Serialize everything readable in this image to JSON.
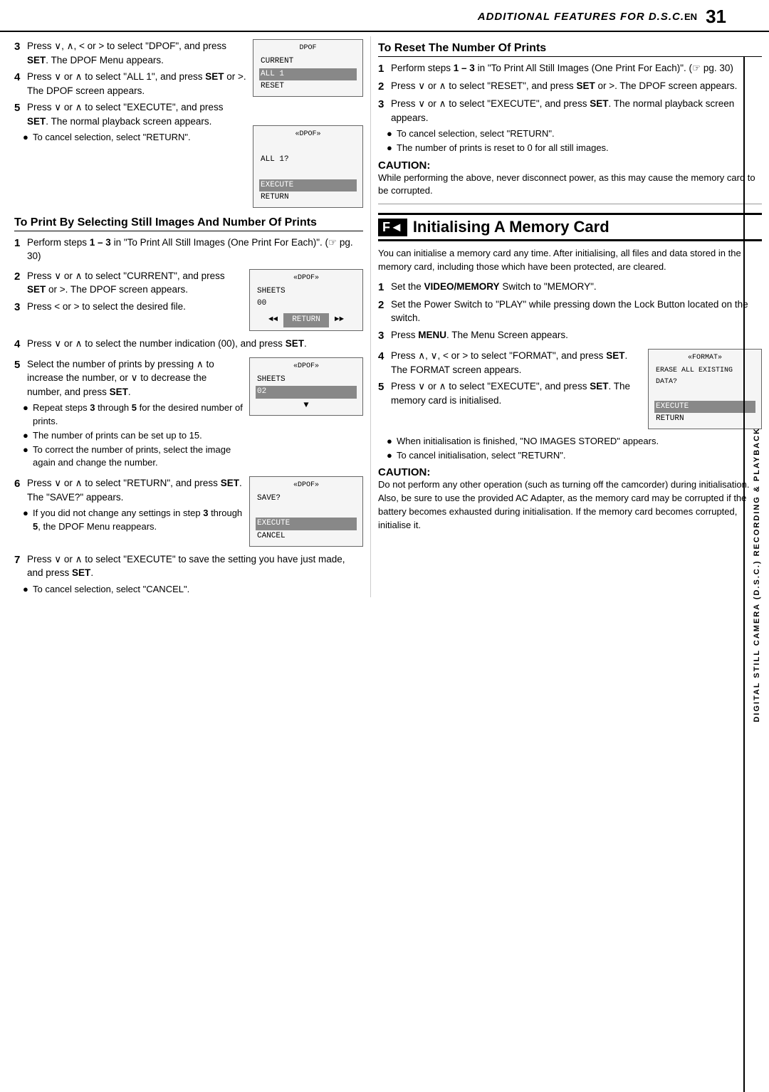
{
  "header": {
    "title": "ADDITIONAL FEATURES FOR D.S.C.",
    "en_label": "EN",
    "page_number": "31"
  },
  "side_label": {
    "text": "DIGITAL STILL CAMERA (D.S.C.) RECORDING & PLAYBACK"
  },
  "left_column": {
    "top_steps": [
      {
        "num": "3",
        "text": "Press ∨, ∧, < or > to select \"DPOF\", and press SET. The DPOF Menu appears."
      },
      {
        "num": "4",
        "text": "Press ∨ or ∧ to select \"ALL 1\", and press SET or >. The DPOF screen appears."
      },
      {
        "num": "5",
        "text": "Press ∨ or ∧ to select \"EXECUTE\", and press SET. The normal playback screen appears."
      }
    ],
    "top_bullet": "To cancel selection, select \"RETURN\".",
    "top_screen1": {
      "title": "DPOF",
      "rows": [
        "CURRENT",
        "ALL 1",
        "RESET"
      ],
      "highlighted": 1
    },
    "top_screen2": {
      "title": "«DPOF»",
      "rows": [
        "",
        "ALL 1?",
        "",
        "EXECUTE",
        "RETURN"
      ],
      "highlighted": 3
    },
    "section1_title": "To Print By Selecting Still Images And Number Of Prints",
    "section1_steps": [
      {
        "num": "1",
        "text": "Perform steps 1 – 3 in \"To Print All Still Images (One Print For Each)\". (☞ pg. 30)"
      },
      {
        "num": "2",
        "text": "Press ∨ or ∧ to select \"CURRENT\", and press SET or >. The DPOF screen appears.",
        "screen": {
          "title": "«DPOF»",
          "rows": [
            "SHEETS",
            "00"
          ],
          "nav": true
        }
      },
      {
        "num": "3",
        "text": "Press < or > to select the desired file.",
        "screen": null
      },
      {
        "num": "4",
        "text": "Press ∨ or ∧ to select the number indication (00), and press SET."
      },
      {
        "num": "5",
        "text": "Select the number of prints by pressing ∧ to increase the number, or ∨ to decrease the number, and press SET.",
        "screen": {
          "title": "«DPOF»",
          "rows": [
            "SHEETS",
            "02"
          ],
          "highlighted_row": 1,
          "nav": false
        }
      }
    ],
    "section1_bullets": [
      "Repeat steps 3 through 5 for the desired number of prints.",
      "The number of prints can be set up to 15.",
      "To correct the number of prints, select the image again and change the number."
    ],
    "section1_step6": {
      "num": "6",
      "text": "Press ∨ or ∧ to select \"RETURN\", and press SET. The \"SAVE?\" appears.",
      "screen": {
        "title": "«DPOF»",
        "rows": [
          "SAVE?",
          "",
          "EXECUTE",
          "CANCEL"
        ],
        "highlighted_row": 2
      },
      "bullets": [
        "If you did not change any settings in step 3 through 5, the DPOF Menu reappears."
      ]
    },
    "section1_step7": {
      "num": "7",
      "text": "Press ∨ or ∧ to select \"EXECUTE\" to save the setting you have just made, and press SET."
    },
    "section1_last_bullet": "To cancel selection, select \"CANCEL\"."
  },
  "right_column": {
    "reset_section_title": "To Reset The Number Of Prints",
    "reset_steps": [
      {
        "num": "1",
        "text": "Perform steps 1 – 3 in \"To Print All Still Images (One Print For Each)\". (☞ pg. 30)"
      },
      {
        "num": "2",
        "text": "Press ∨ or ∧ to select \"RESET\", and press SET or >. The DPOF screen appears."
      },
      {
        "num": "3",
        "text": "Press ∨ or ∧ to select \"EXECUTE\", and press SET. The normal playback screen appears."
      }
    ],
    "reset_bullets": [
      "To cancel selection, select \"RETURN\".",
      "The number of prints is reset to 0 for all still images."
    ],
    "caution1_title": "CAUTION:",
    "caution1_text": "While performing the above, never disconnect power, as this may cause the memory card to be corrupted.",
    "init_section_title": "F◄Initialising A Memory Card",
    "init_intro": "You can initialise a memory card any time. After initialising, all files and data stored in the memory card, including those which have been protected, are cleared.",
    "init_steps": [
      {
        "num": "1",
        "text": "Set the VIDEO/MEMORY Switch to \"MEMORY\"."
      },
      {
        "num": "2",
        "text": "Set the Power Switch to \"PLAY\" while pressing down the Lock Button located on the switch."
      },
      {
        "num": "3",
        "text": "Press MENU. The Menu Screen appears."
      },
      {
        "num": "4",
        "text": "Press ∧, ∨, < or > to select \"FORMAT\", and press SET. The FORMAT screen appears.",
        "screen": {
          "title": "«FORMAT»",
          "rows": [
            "ERASE ALL EXISTING DATA?",
            "",
            "EXECUTE",
            "RETURN"
          ],
          "highlighted_row": 2
        }
      },
      {
        "num": "5",
        "text": "Press ∨ or ∧ to select \"EXECUTE\", and press SET. The memory card is initialised.",
        "screen": null
      }
    ],
    "init_bullets": [
      "When initialisation is finished, \"NO IMAGES STORED\" appears.",
      "To cancel initialisation, select \"RETURN\"."
    ],
    "caution2_title": "CAUTION:",
    "caution2_text": "Do not perform any other operation (such as turning off the camcorder) during initialisation. Also, be sure to use the provided AC Adapter, as the memory card may be corrupted if the battery becomes exhausted during initialisation. If the memory card becomes corrupted, initialise it."
  }
}
